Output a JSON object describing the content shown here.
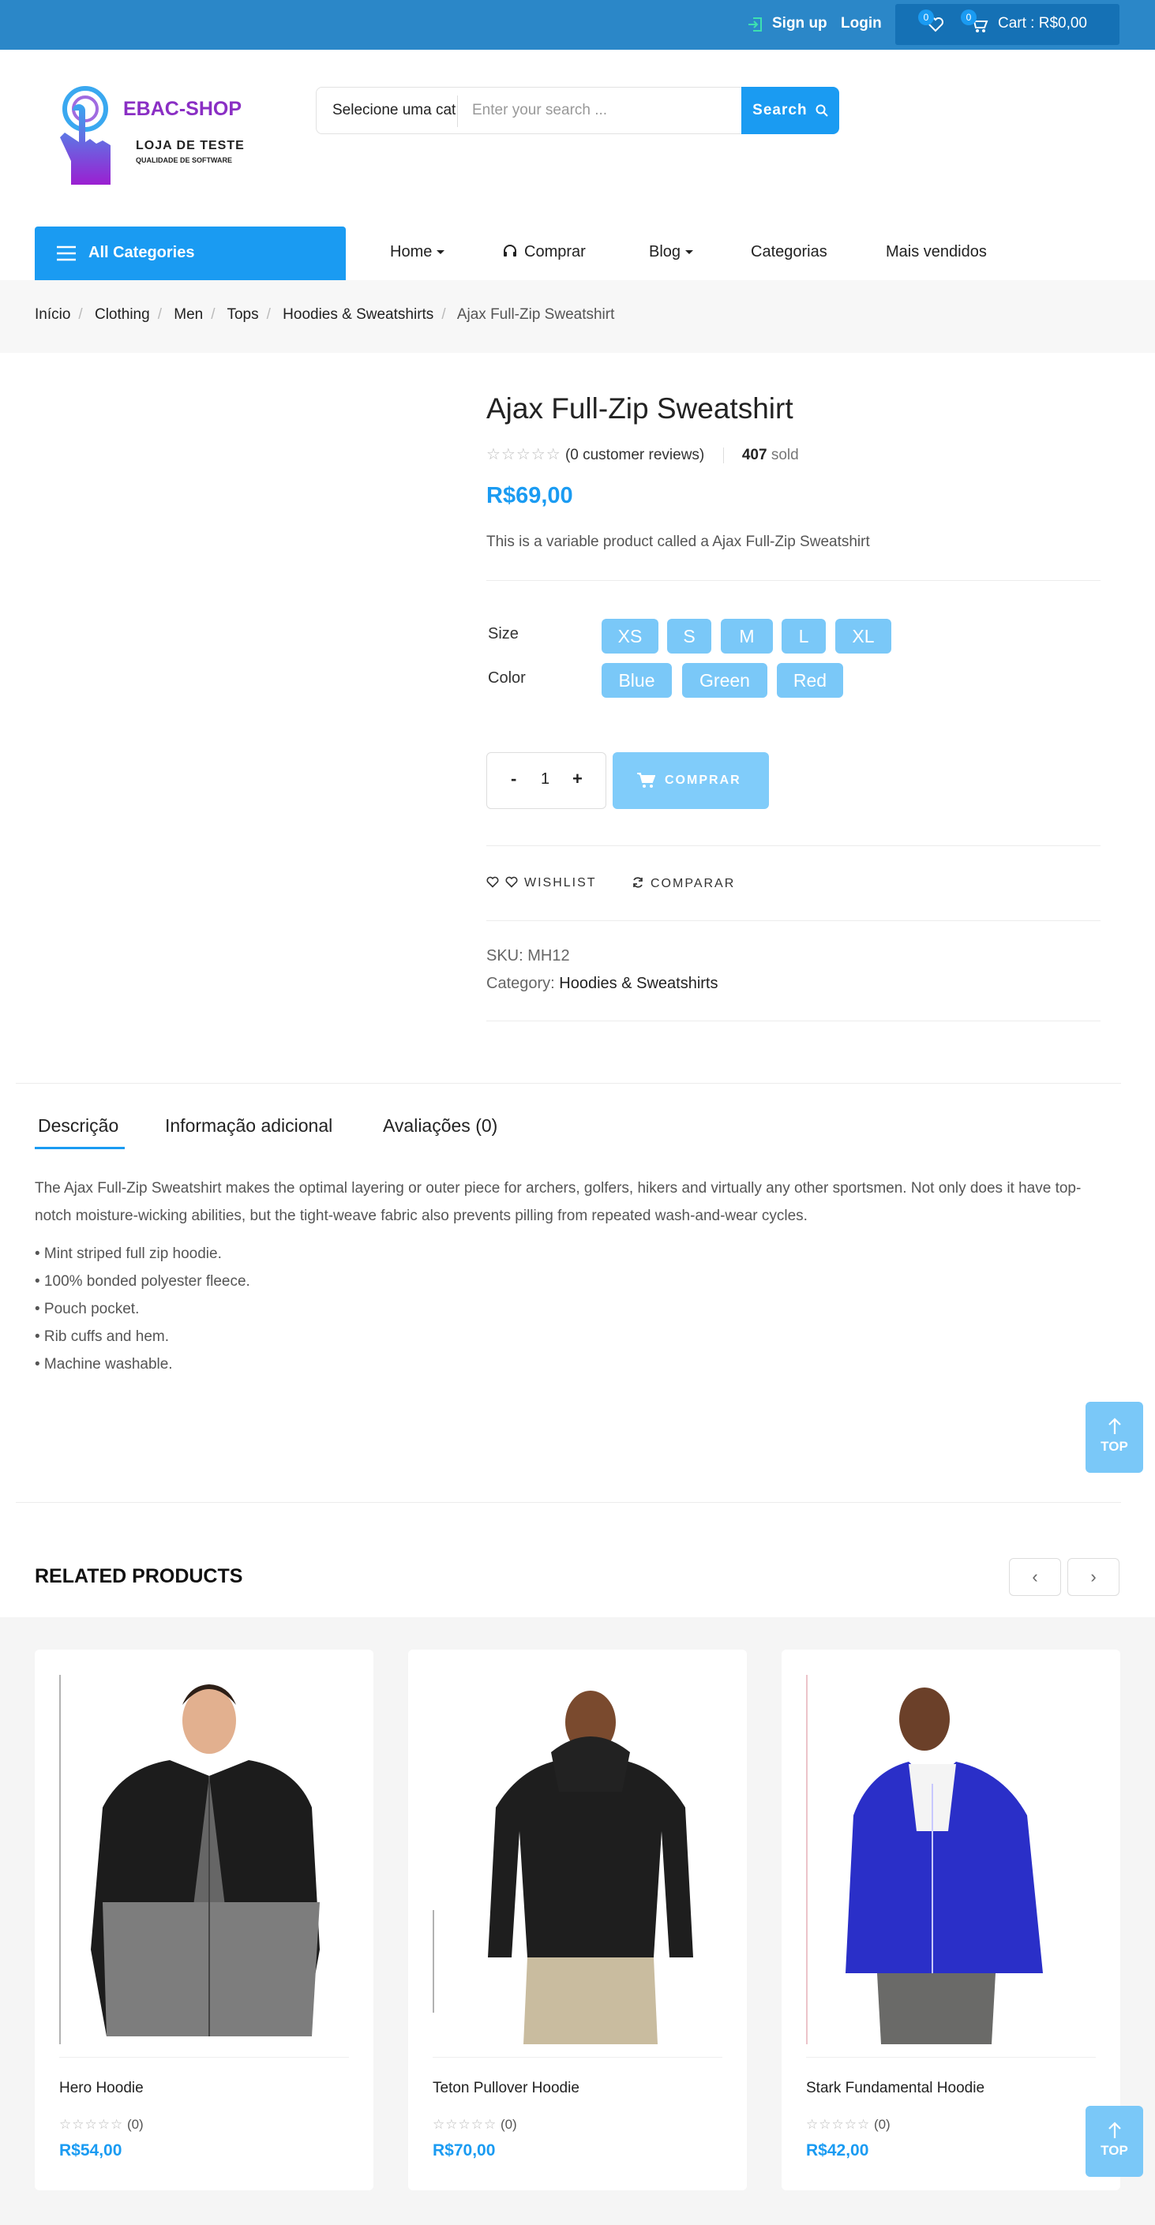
{
  "topbar": {
    "signup": "Sign up",
    "login": "Login",
    "wishlist_count": "0",
    "cart_count": "0",
    "cart_label": "Cart : R$0,00"
  },
  "logo": {
    "brand": "EBAC-SHOP",
    "subtitle": "LOJA DE TESTE",
    "tagline": "QUALIDADE DE SOFTWARE"
  },
  "search": {
    "category": "Selecione uma cat",
    "placeholder": "Enter your search ...",
    "button": "Search"
  },
  "nav": {
    "all_categories": "All Categories",
    "items": [
      "Home",
      "Comprar",
      "Blog",
      "Categorias",
      "Mais vendidos"
    ]
  },
  "breadcrumb": [
    "Início",
    "Clothing",
    "Men",
    "Tops",
    "Hoodies & Sweatshirts",
    "Ajax Full-Zip Sweatshirt"
  ],
  "product": {
    "title": "Ajax Full-Zip Sweatshirt",
    "reviews": "(0 customer reviews)",
    "sold_count": "407",
    "sold_label": "sold",
    "price": "R$69,00",
    "short_desc": "This is a variable product called a Ajax Full-Zip Sweatshirt",
    "size_label": "Size",
    "sizes": [
      "XS",
      "S",
      "M",
      "L",
      "XL"
    ],
    "color_label": "Color",
    "colors": [
      "Blue",
      "Green",
      "Red"
    ],
    "qty_minus": "-",
    "qty": "1",
    "qty_plus": "+",
    "buy_label": "COMPRAR",
    "wishlist_label": "WISHLIST",
    "compare_label": "COMPARAR",
    "sku_label": "SKU:",
    "sku": "MH12",
    "category_label": "Category:",
    "category": "Hoodies & Sweatshirts"
  },
  "tabs": [
    "Descrição",
    "Informação adicional",
    "Avaliações (0)"
  ],
  "description": {
    "text": "The Ajax Full-Zip Sweatshirt makes the optimal layering or outer piece for archers, golfers, hikers and virtually any other sportsmen. Not only does it have top-notch moisture-wicking abilities, but the tight-weave fabric also prevents pilling from repeated wash-and-wear cycles.",
    "bullets": [
      "• Mint striped full zip hoodie.",
      "• 100% bonded polyester fleece.",
      "• Pouch pocket.",
      "• Rib cuffs and hem.",
      "• Machine washable."
    ]
  },
  "top_button": "TOP",
  "related": {
    "heading": "RELATED PRODUCTS",
    "products": [
      {
        "name": "Hero Hoodie",
        "rating": "(0)",
        "price": "R$54,00"
      },
      {
        "name": "Teton Pullover Hoodie",
        "rating": "(0)",
        "price": "R$70,00"
      },
      {
        "name": "Stark Fundamental Hoodie",
        "rating": "(0)",
        "price": "R$42,00"
      }
    ]
  },
  "colors": {
    "accent": "#1a9bf2",
    "topbar": "#2b87c8",
    "swatch": "#7ac8f8"
  }
}
